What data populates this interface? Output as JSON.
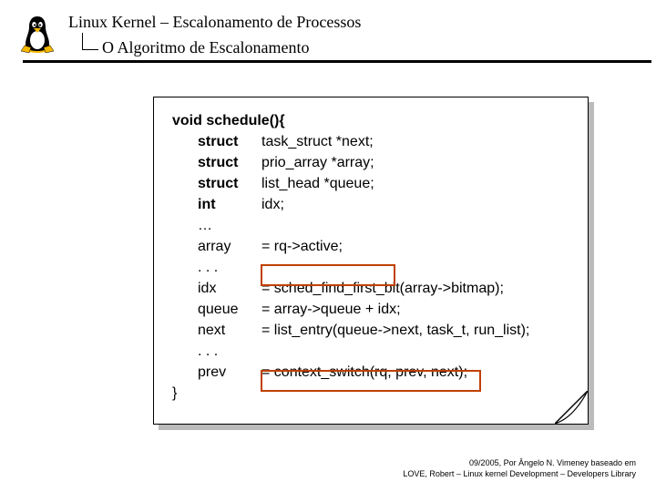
{
  "header": {
    "title": "Linux Kernel – Escalonamento de Processos",
    "subtitle": "O Algoritmo de Escalonamento"
  },
  "code": {
    "sig_void": "void ",
    "sig_fn": "schedule(){",
    "rows": [
      {
        "c1": "struct",
        "c1b": true,
        "c2": "task_struct *next;"
      },
      {
        "c1": "struct",
        "c1b": true,
        "c2": "prio_array *array;"
      },
      {
        "c1": "struct",
        "c1b": true,
        "c2": "list_head *queue;"
      },
      {
        "c1": "int",
        "c1b": true,
        "c2": "idx;"
      },
      {
        "c1": "…",
        "c1b": false,
        "c2": ""
      },
      {
        "c1": "array",
        "c1b": false,
        "c2": "= rq->active;"
      },
      {
        "c1": ". . .",
        "c1b": false,
        "c2": ""
      },
      {
        "c1": "idx",
        "c1b": false,
        "c2": "= sched_find_first_bit(array->bitmap);"
      },
      {
        "c1": "queue",
        "c1b": false,
        "c2": "= array->queue + idx;"
      },
      {
        "c1": "next",
        "c1b": false,
        "c2": "= list_entry(queue->next, task_t, run_list);"
      },
      {
        "c1": ". . .",
        "c1b": false,
        "c2": ""
      },
      {
        "c1": "prev",
        "c1b": false,
        "c2": "= context_switch(rq, prev, next);"
      }
    ],
    "close": "}"
  },
  "footer": {
    "line1": "09/2005, Por Ângelo N. Vimeney baseado em",
    "line2": "LOVE, Robert – Linux kernel Development – Developers Library"
  },
  "icons": {
    "logo": "tux-icon"
  }
}
